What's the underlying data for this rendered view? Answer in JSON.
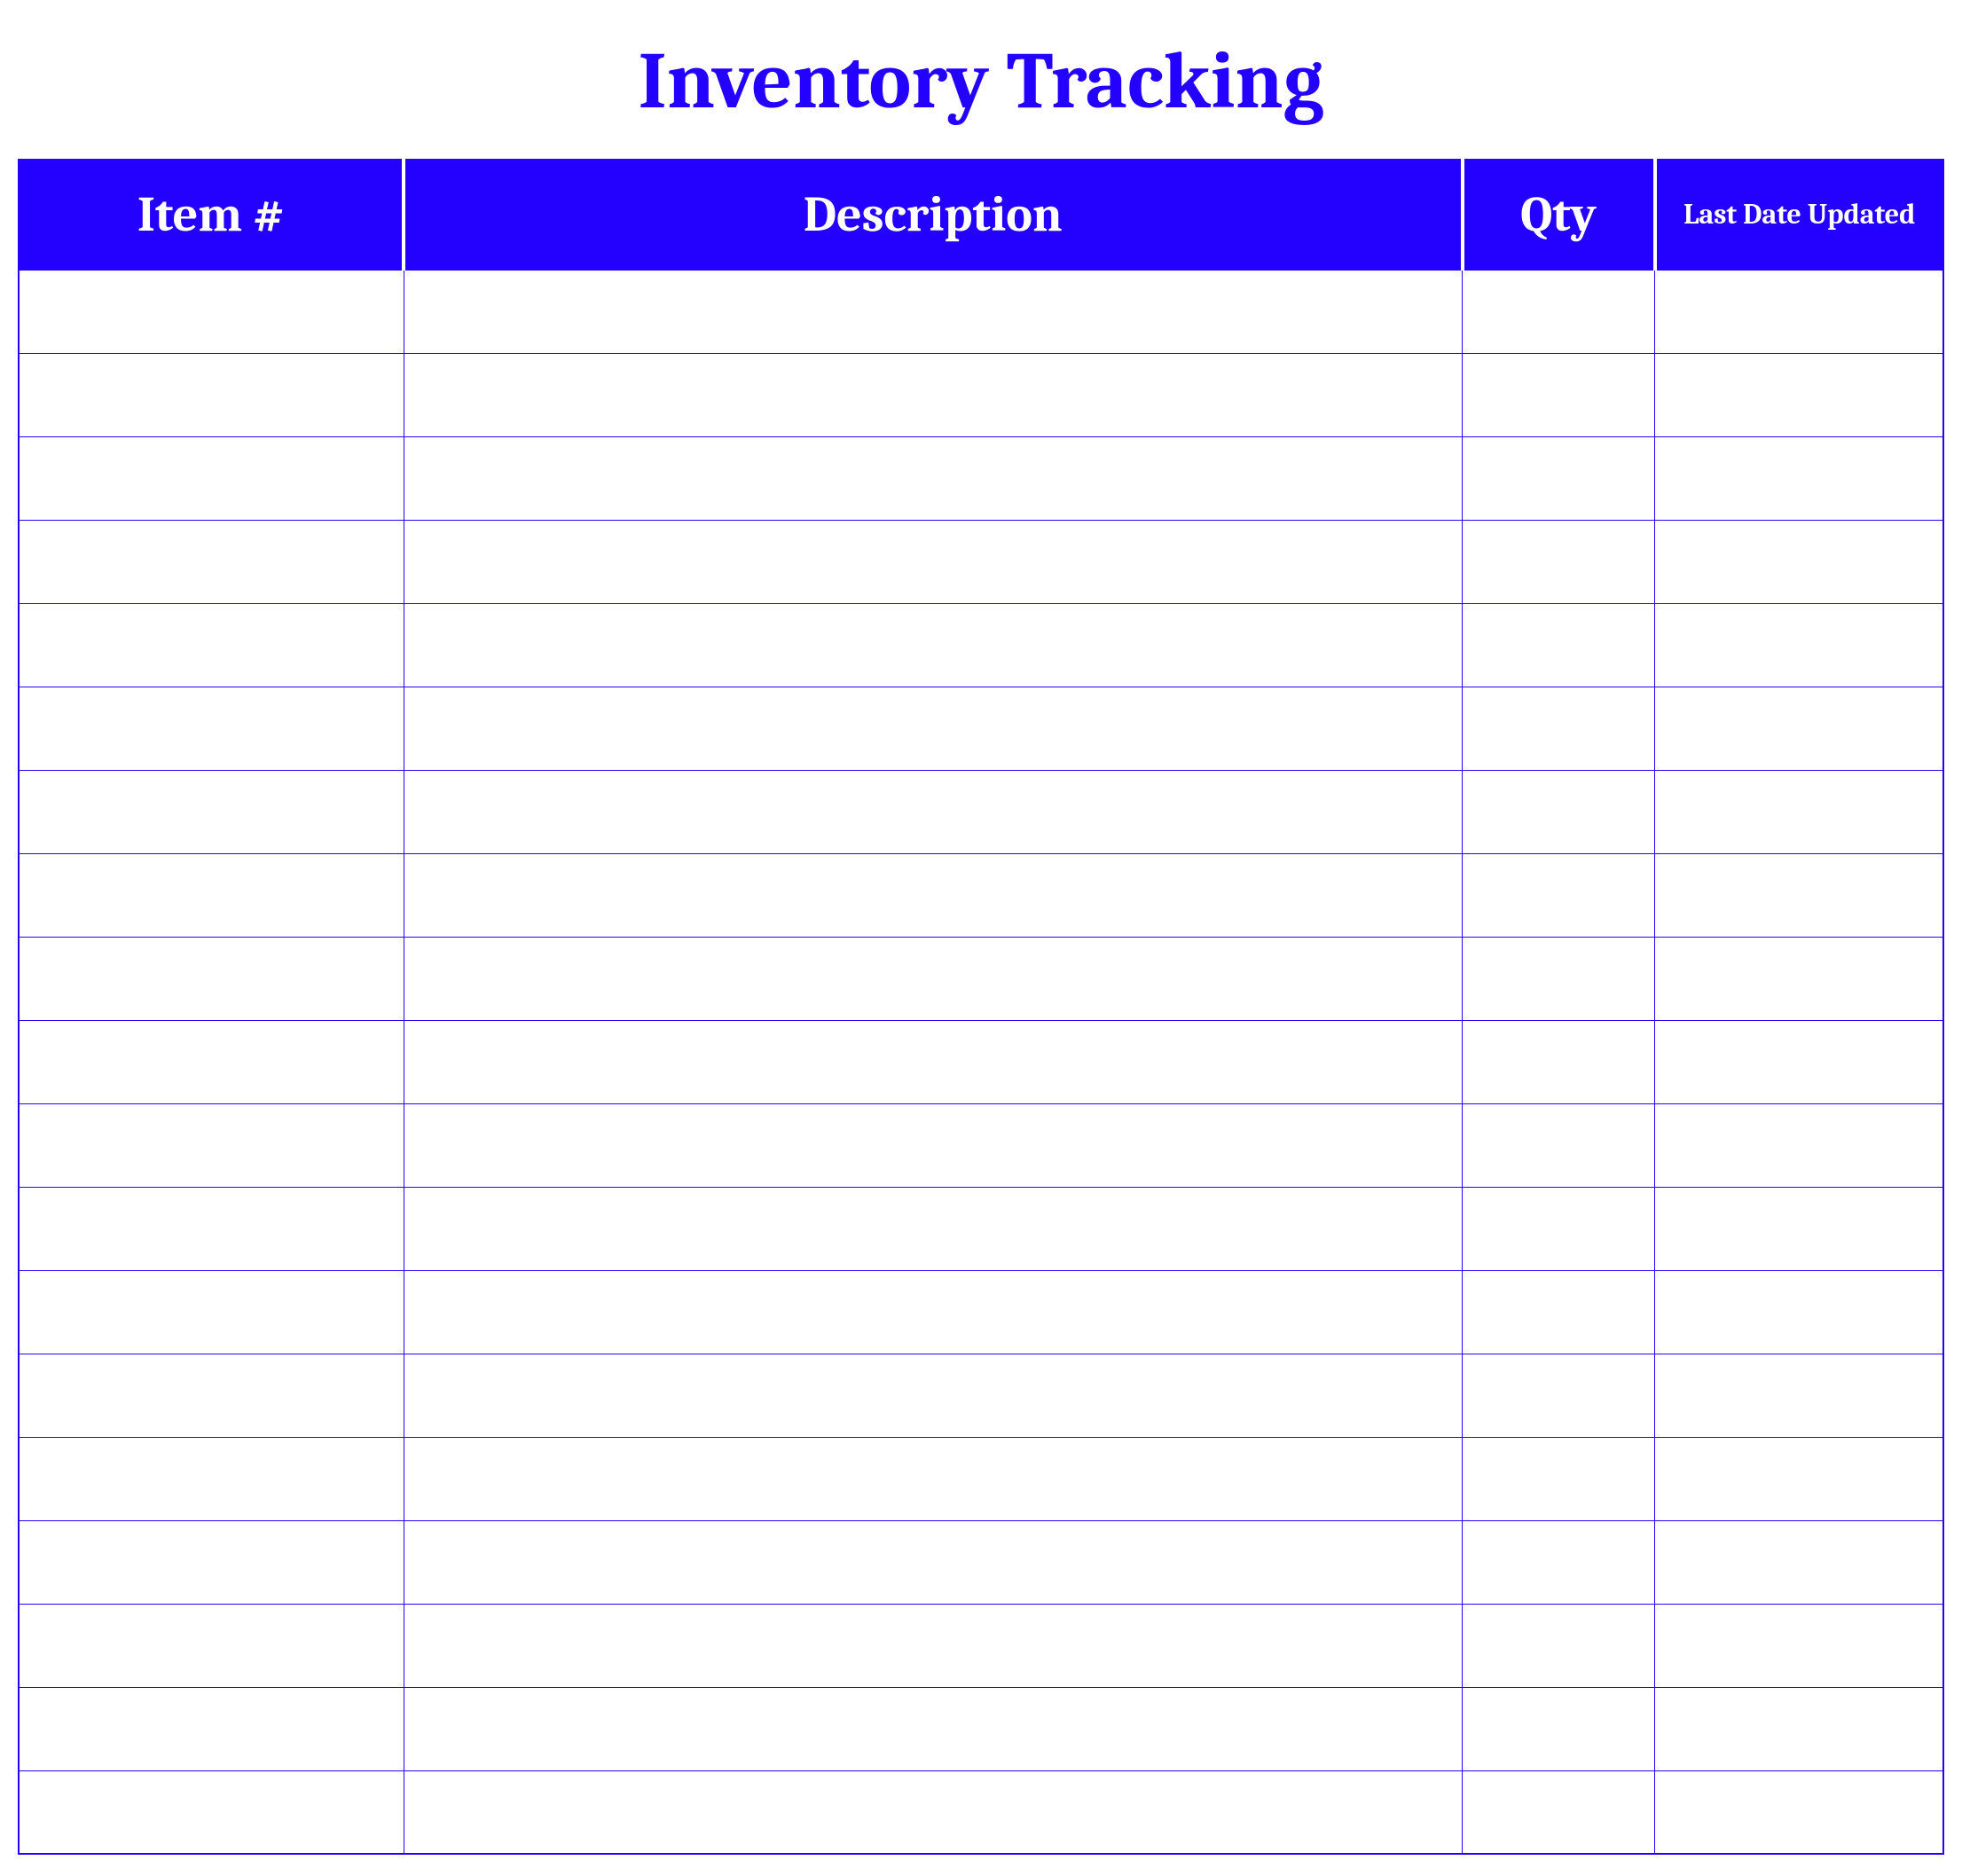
{
  "title": "Inventory Tracking",
  "columns": {
    "item": "Item #",
    "description": "Description",
    "qty": "Qty",
    "lastDate": "Last Date Updated"
  },
  "rows": [
    {
      "item": "",
      "description": "",
      "qty": "",
      "lastDate": ""
    },
    {
      "item": "",
      "description": "",
      "qty": "",
      "lastDate": ""
    },
    {
      "item": "",
      "description": "",
      "qty": "",
      "lastDate": ""
    },
    {
      "item": "",
      "description": "",
      "qty": "",
      "lastDate": ""
    },
    {
      "item": "",
      "description": "",
      "qty": "",
      "lastDate": ""
    },
    {
      "item": "",
      "description": "",
      "qty": "",
      "lastDate": ""
    },
    {
      "item": "",
      "description": "",
      "qty": "",
      "lastDate": ""
    },
    {
      "item": "",
      "description": "",
      "qty": "",
      "lastDate": ""
    },
    {
      "item": "",
      "description": "",
      "qty": "",
      "lastDate": ""
    },
    {
      "item": "",
      "description": "",
      "qty": "",
      "lastDate": ""
    },
    {
      "item": "",
      "description": "",
      "qty": "",
      "lastDate": ""
    },
    {
      "item": "",
      "description": "",
      "qty": "",
      "lastDate": ""
    },
    {
      "item": "",
      "description": "",
      "qty": "",
      "lastDate": ""
    },
    {
      "item": "",
      "description": "",
      "qty": "",
      "lastDate": ""
    },
    {
      "item": "",
      "description": "",
      "qty": "",
      "lastDate": ""
    },
    {
      "item": "",
      "description": "",
      "qty": "",
      "lastDate": ""
    },
    {
      "item": "",
      "description": "",
      "qty": "",
      "lastDate": ""
    },
    {
      "item": "",
      "description": "",
      "qty": "",
      "lastDate": ""
    },
    {
      "item": "",
      "description": "",
      "qty": "",
      "lastDate": ""
    }
  ]
}
